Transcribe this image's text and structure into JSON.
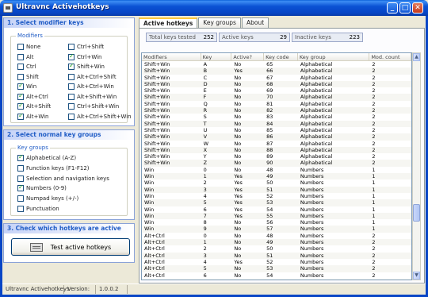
{
  "window": {
    "title": "Ultravnc Activehotkeys",
    "minimize": "_",
    "maximize": "□",
    "close": "✕",
    "title_icon": "keyboard-icon"
  },
  "section1": {
    "title": "1. Select modifier keys",
    "group_label": "Modifiers",
    "modifiers": [
      {
        "label": "None",
        "checked": false
      },
      {
        "label": "Alt",
        "checked": false
      },
      {
        "label": "Ctrl",
        "checked": false
      },
      {
        "label": "Shift",
        "checked": false
      },
      {
        "label": "Win",
        "checked": true
      },
      {
        "label": "Alt+Ctrl",
        "checked": true
      },
      {
        "label": "Alt+Shift",
        "checked": true
      },
      {
        "label": "Alt+Win",
        "checked": true
      },
      {
        "label": "Ctrl+Shift",
        "checked": false
      },
      {
        "label": "Ctrl+Win",
        "checked": true
      },
      {
        "label": "Shift+Win",
        "checked": true
      },
      {
        "label": "Alt+Ctrl+Shift",
        "checked": false
      },
      {
        "label": "Alt+Ctrl+Win",
        "checked": false
      },
      {
        "label": "Alt+Shift+Win",
        "checked": false
      },
      {
        "label": "Ctrl+Shift+Win",
        "checked": false
      },
      {
        "label": "Alt+Ctrl+Shift+Win",
        "checked": false
      }
    ]
  },
  "section2": {
    "title": "2. Select normal key groups",
    "group_label": "Key groups",
    "groups": [
      {
        "label": "Alphabetical (A-Z)",
        "checked": true
      },
      {
        "label": "Function keys (F1-F12)",
        "checked": false
      },
      {
        "label": "Selection and navigation keys",
        "checked": false
      },
      {
        "label": "Numbers (0-9)",
        "checked": true
      },
      {
        "label": "Numpad keys (+/-)",
        "checked": false
      },
      {
        "label": "Punctuation",
        "checked": false
      }
    ]
  },
  "section3": {
    "title": "3. Check which hotkeys are active",
    "button_label": "Test active hotkeys",
    "button_icon": "keyboard-icon"
  },
  "tabs": [
    {
      "label": "Active hotkeys",
      "active": true
    },
    {
      "label": "Key groups",
      "active": false
    },
    {
      "label": "About",
      "active": false
    }
  ],
  "stats": [
    {
      "label": "Total keys tested",
      "value": "252"
    },
    {
      "label": "Active keys",
      "value": "29"
    },
    {
      "label": "Inactive keys",
      "value": "223"
    }
  ],
  "table": {
    "columns": [
      "Modifiers",
      "Key",
      "Active?",
      "Key code",
      "Key group",
      "Mod. count"
    ],
    "rows": [
      [
        "Shift+Win",
        "A",
        "No",
        "65",
        "Alphabetical",
        "2"
      ],
      [
        "Shift+Win",
        "B",
        "Yes",
        "66",
        "Alphabetical",
        "2"
      ],
      [
        "Shift+Win",
        "C",
        "No",
        "67",
        "Alphabetical",
        "2"
      ],
      [
        "Shift+Win",
        "D",
        "No",
        "68",
        "Alphabetical",
        "2"
      ],
      [
        "Shift+Win",
        "E",
        "No",
        "69",
        "Alphabetical",
        "2"
      ],
      [
        "Shift+Win",
        "F",
        "No",
        "70",
        "Alphabetical",
        "2"
      ],
      [
        "Shift+Win",
        "Q",
        "No",
        "81",
        "Alphabetical",
        "2"
      ],
      [
        "Shift+Win",
        "R",
        "No",
        "82",
        "Alphabetical",
        "2"
      ],
      [
        "Shift+Win",
        "S",
        "No",
        "83",
        "Alphabetical",
        "2"
      ],
      [
        "Shift+Win",
        "T",
        "No",
        "84",
        "Alphabetical",
        "2"
      ],
      [
        "Shift+Win",
        "U",
        "No",
        "85",
        "Alphabetical",
        "2"
      ],
      [
        "Shift+Win",
        "V",
        "No",
        "86",
        "Alphabetical",
        "2"
      ],
      [
        "Shift+Win",
        "W",
        "No",
        "87",
        "Alphabetical",
        "2"
      ],
      [
        "Shift+Win",
        "X",
        "No",
        "88",
        "Alphabetical",
        "2"
      ],
      [
        "Shift+Win",
        "Y",
        "No",
        "89",
        "Alphabetical",
        "2"
      ],
      [
        "Shift+Win",
        "Z",
        "No",
        "90",
        "Alphabetical",
        "2"
      ],
      [
        "Win",
        "0",
        "No",
        "48",
        "Numbers",
        "1"
      ],
      [
        "Win",
        "1",
        "Yes",
        "49",
        "Numbers",
        "1"
      ],
      [
        "Win",
        "2",
        "Yes",
        "50",
        "Numbers",
        "1"
      ],
      [
        "Win",
        "3",
        "Yes",
        "51",
        "Numbers",
        "1"
      ],
      [
        "Win",
        "4",
        "Yes",
        "52",
        "Numbers",
        "1"
      ],
      [
        "Win",
        "5",
        "Yes",
        "53",
        "Numbers",
        "1"
      ],
      [
        "Win",
        "6",
        "Yes",
        "54",
        "Numbers",
        "1"
      ],
      [
        "Win",
        "7",
        "Yes",
        "55",
        "Numbers",
        "1"
      ],
      [
        "Win",
        "8",
        "No",
        "56",
        "Numbers",
        "1"
      ],
      [
        "Win",
        "9",
        "No",
        "57",
        "Numbers",
        "1"
      ],
      [
        "Alt+Ctrl",
        "0",
        "No",
        "48",
        "Numbers",
        "2"
      ],
      [
        "Alt+Ctrl",
        "1",
        "No",
        "49",
        "Numbers",
        "2"
      ],
      [
        "Alt+Ctrl",
        "2",
        "No",
        "50",
        "Numbers",
        "2"
      ],
      [
        "Alt+Ctrl",
        "3",
        "No",
        "51",
        "Numbers",
        "2"
      ],
      [
        "Alt+Ctrl",
        "4",
        "Yes",
        "52",
        "Numbers",
        "2"
      ],
      [
        "Alt+Ctrl",
        "5",
        "No",
        "53",
        "Numbers",
        "2"
      ],
      [
        "Alt+Ctrl",
        "6",
        "No",
        "54",
        "Numbers",
        "2"
      ],
      [
        "Alt+Ctrl",
        "7",
        "No",
        "55",
        "Numbers",
        "2"
      ]
    ]
  },
  "statusbar": {
    "app": "Ultravnc Activehotkeys",
    "version_label": "Version:",
    "version": "1.0.0.2"
  }
}
